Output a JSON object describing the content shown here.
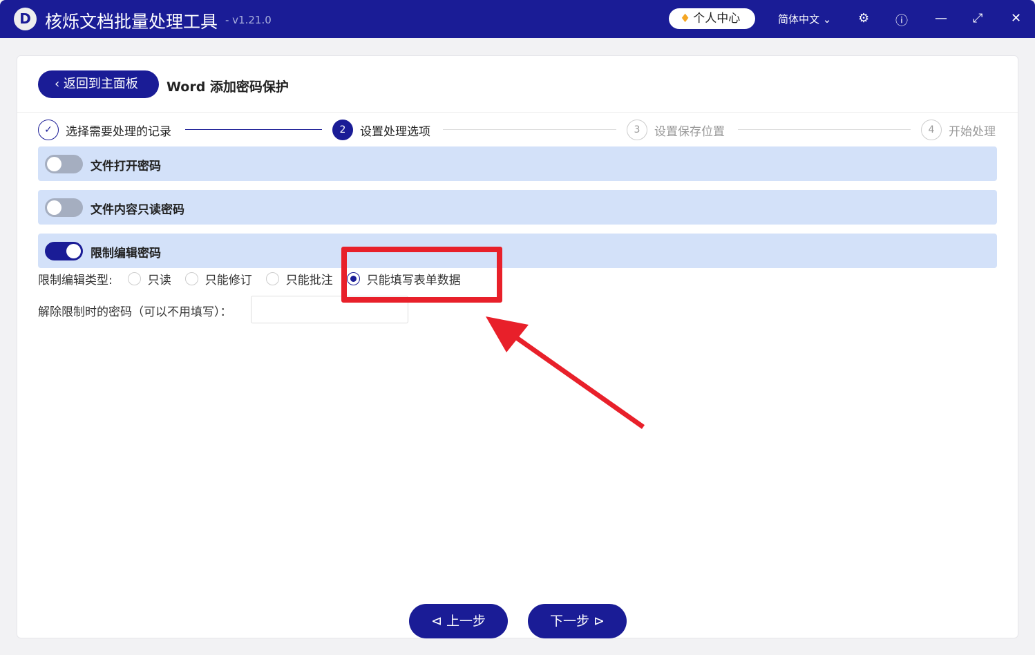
{
  "app": {
    "title": "核烁文档批量处理工具",
    "version": "- v1.21.0",
    "logo": "D",
    "user_center": "个人中心",
    "language": "简体中文"
  },
  "header": {
    "back_label": "返回到主面板",
    "page_title": "Word 添加密码保护"
  },
  "steps": [
    {
      "num": "✓",
      "label": "选择需要处理的记录"
    },
    {
      "num": "2",
      "label": "设置处理选项"
    },
    {
      "num": "3",
      "label": "设置保存位置"
    },
    {
      "num": "4",
      "label": "开始处理"
    }
  ],
  "panels": [
    {
      "label": "文件打开密码",
      "on": false
    },
    {
      "label": "文件内容只读密码",
      "on": false
    },
    {
      "label": "限制编辑密码",
      "on": true
    }
  ],
  "restrict": {
    "type_label": "限制编辑类型:",
    "options": [
      "只读",
      "只能修订",
      "只能批注",
      "只能填写表单数据"
    ],
    "selected": "只能填写表单数据",
    "password_label": "解除限制时的密码（可以不用填写）：",
    "password_value": ""
  },
  "footer": {
    "prev": "上一步",
    "next": "下一步"
  },
  "colors": {
    "primary": "#1a1c96",
    "panel": "#d3e1f9",
    "annotation": "#e8202a"
  }
}
